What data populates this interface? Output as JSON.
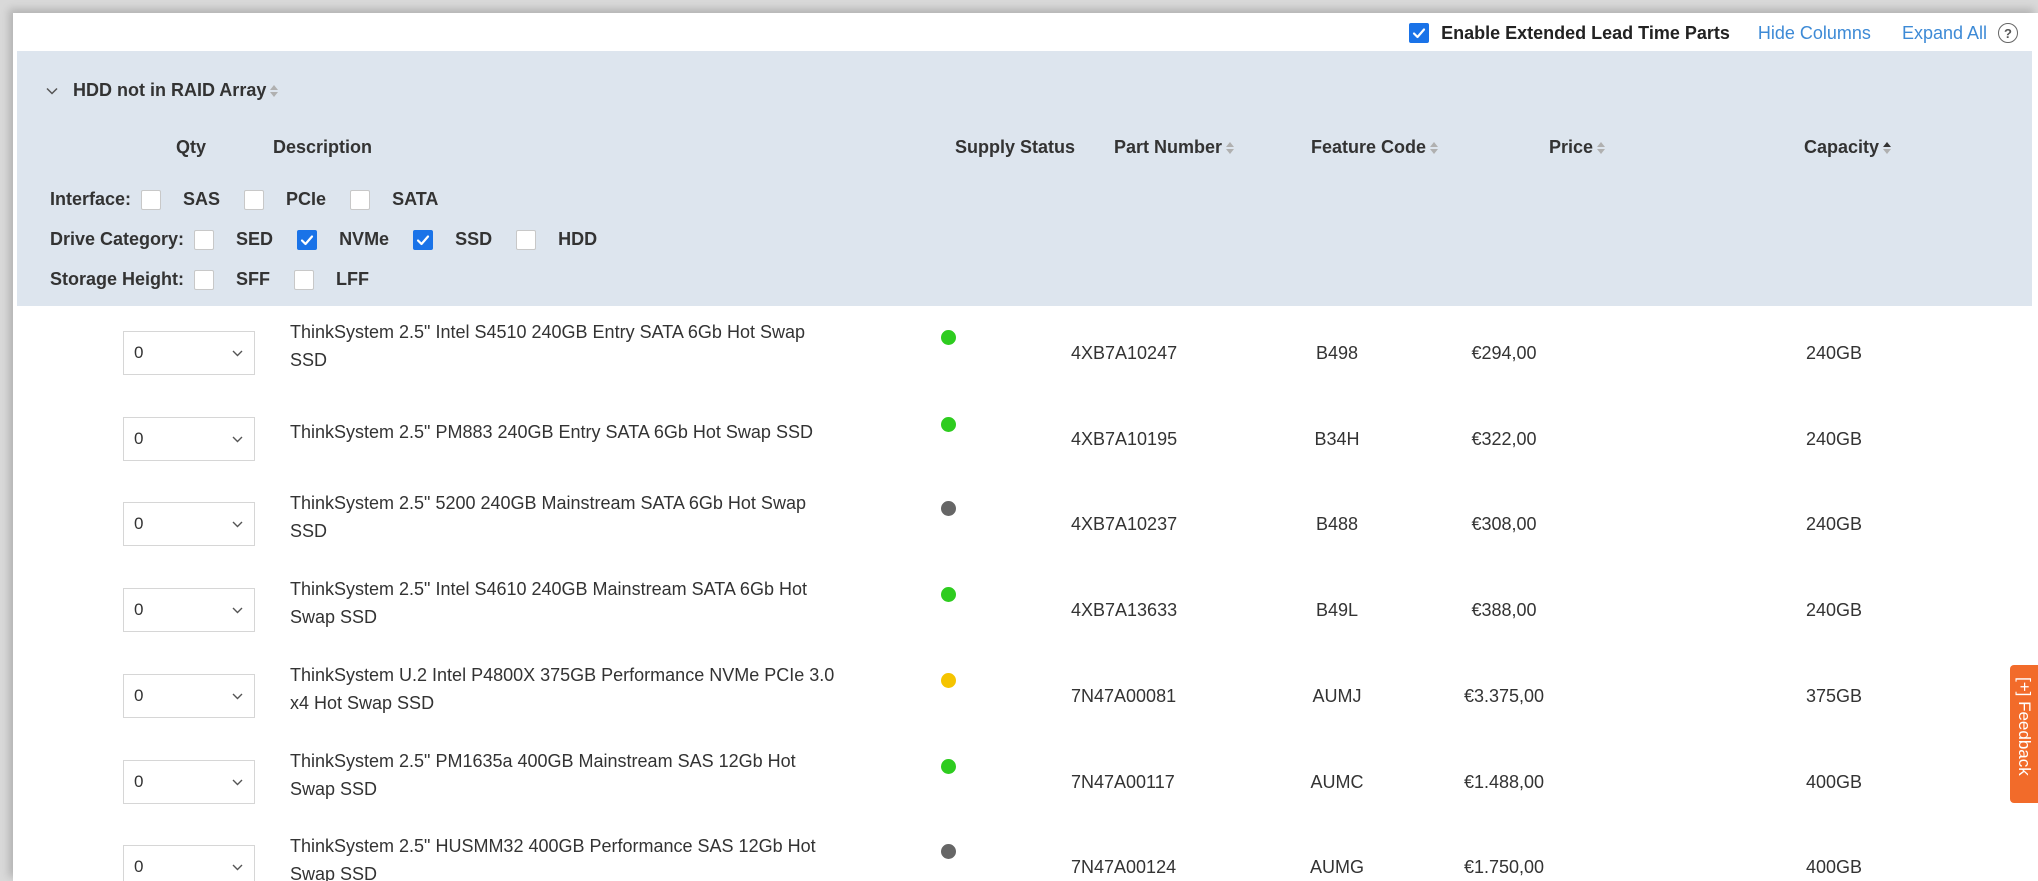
{
  "toolbar": {
    "extended_lead_label": "Enable Extended Lead Time Parts",
    "extended_lead_checked": true,
    "hide_columns": "Hide Columns",
    "expand_all": "Expand All",
    "help_glyph": "?"
  },
  "group": {
    "title": "HDD not in RAID Array"
  },
  "columns": {
    "qty": "Qty",
    "description": "Description",
    "supply_status": "Supply Status",
    "part_number": "Part Number",
    "feature_code": "Feature Code",
    "price": "Price",
    "capacity": "Capacity"
  },
  "filters": {
    "interface": {
      "label": "Interface:",
      "options": [
        {
          "label": "SAS",
          "checked": false
        },
        {
          "label": "PCIe",
          "checked": false
        },
        {
          "label": "SATA",
          "checked": false
        }
      ]
    },
    "drive_category": {
      "label": "Drive Category:",
      "options": [
        {
          "label": "SED",
          "checked": false
        },
        {
          "label": "NVMe",
          "checked": true
        },
        {
          "label": "SSD",
          "checked": true
        },
        {
          "label": "HDD",
          "checked": false
        }
      ]
    },
    "storage_height": {
      "label": "Storage Height:",
      "options": [
        {
          "label": "SFF",
          "checked": false
        },
        {
          "label": "LFF",
          "checked": false
        }
      ]
    }
  },
  "status_colors": {
    "green": "#2ecc1f",
    "grey": "#666666",
    "yellow": "#f5c400"
  },
  "rows": [
    {
      "qty": "0",
      "desc_lines": [
        "ThinkSystem 2.5\" Intel S4510 240GB Entry SATA 6Gb Hot Swap",
        "SSD"
      ],
      "status": "green",
      "part": "4XB7A10247",
      "feature": "B498",
      "price": "€294,00",
      "capacity": "240GB"
    },
    {
      "qty": "0",
      "desc_lines": [
        "ThinkSystem 2.5\" PM883 240GB Entry SATA 6Gb Hot Swap SSD"
      ],
      "status": "green",
      "part": "4XB7A10195",
      "feature": "B34H",
      "price": "€322,00",
      "capacity": "240GB"
    },
    {
      "qty": "0",
      "desc_lines": [
        "ThinkSystem 2.5\" 5200 240GB Mainstream SATA 6Gb Hot Swap",
        "SSD"
      ],
      "status": "grey",
      "part": "4XB7A10237",
      "feature": "B488",
      "price": "€308,00",
      "capacity": "240GB"
    },
    {
      "qty": "0",
      "desc_lines": [
        "ThinkSystem 2.5\" Intel S4610 240GB Mainstream SATA 6Gb Hot",
        "Swap SSD"
      ],
      "status": "green",
      "part": "4XB7A13633",
      "feature": "B49L",
      "price": "€388,00",
      "capacity": "240GB"
    },
    {
      "qty": "0",
      "desc_lines": [
        "ThinkSystem U.2 Intel P4800X 375GB Performance NVMe PCIe 3.0",
        "x4 Hot Swap SSD"
      ],
      "status": "yellow",
      "part": "7N47A00081",
      "feature": "AUMJ",
      "price": "€3.375,00",
      "capacity": "375GB"
    },
    {
      "qty": "0",
      "desc_lines": [
        "ThinkSystem 2.5\" PM1635a 400GB Mainstream SAS 12Gb Hot",
        "Swap SSD"
      ],
      "status": "green",
      "part": "7N47A00117",
      "feature": "AUMC",
      "price": "€1.488,00",
      "capacity": "400GB"
    },
    {
      "qty": "0",
      "desc_lines": [
        "ThinkSystem 2.5\" HUSMM32 400GB Performance SAS 12Gb Hot",
        "Swap SSD"
      ],
      "status": "grey",
      "part": "7N47A00124",
      "feature": "AUMG",
      "price": "€1.750,00",
      "capacity": "400GB"
    }
  ],
  "feedback": {
    "label": "[+] Feedback"
  },
  "icons": {
    "checkbox": "check-icon",
    "collapse": "chevron-down-icon",
    "help": "question-circle-icon",
    "sort": "sort-arrows-icon"
  }
}
